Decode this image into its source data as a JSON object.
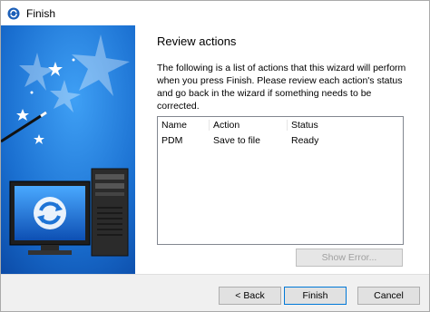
{
  "window": {
    "title": "Finish",
    "icon": "wizard-app-icon"
  },
  "page": {
    "heading": "Review actions",
    "description": "The following is a list of actions that this wizard will perform when you press Finish. Please review each action's status and go back in the wizard if something needs to be corrected."
  },
  "list": {
    "columns": [
      "Name",
      "Action",
      "Status"
    ],
    "rows": [
      {
        "name": "PDM",
        "action": "Save to file",
        "status": "Ready"
      }
    ]
  },
  "buttons": {
    "show_error": "Show Error...",
    "back": "< Back",
    "finish": "Finish",
    "cancel": "Cancel"
  },
  "colors": {
    "side_panel_blue": "#1a6fd0",
    "focus_border": "#0078d7"
  }
}
